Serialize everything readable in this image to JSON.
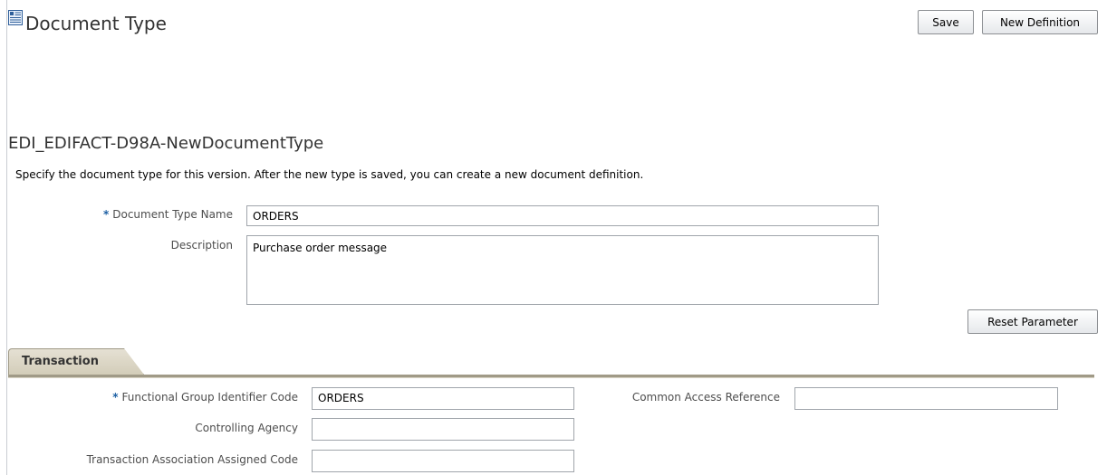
{
  "header": {
    "title": "Document Type",
    "save_label": "Save",
    "new_definition_label": "New Definition"
  },
  "document": {
    "heading": "EDI_EDIFACT-D98A-NewDocumentType",
    "instructions": "Specify the document type for this version. After the new type is saved, you can create a new document definition."
  },
  "form": {
    "required_marker": "*",
    "doc_type_name_label": "Document Type Name",
    "doc_type_name_value": "ORDERS",
    "description_label": "Description",
    "description_value": "Purchase order message",
    "reset_label": "Reset Parameter"
  },
  "transaction": {
    "tab_label": "Transaction",
    "functional_group_label": "Functional Group Identifier Code",
    "functional_group_value": "ORDERS",
    "controlling_agency_label": "Controlling Agency",
    "controlling_agency_value": "",
    "assoc_code_label": "Transaction Association Assigned Code",
    "assoc_code_value": "",
    "common_access_label": "Common Access Reference",
    "common_access_value": ""
  },
  "colors": {
    "required_star": "#1d60a4",
    "tab_bg": "#d9d4c4",
    "tab_rule": "#a09a87"
  }
}
